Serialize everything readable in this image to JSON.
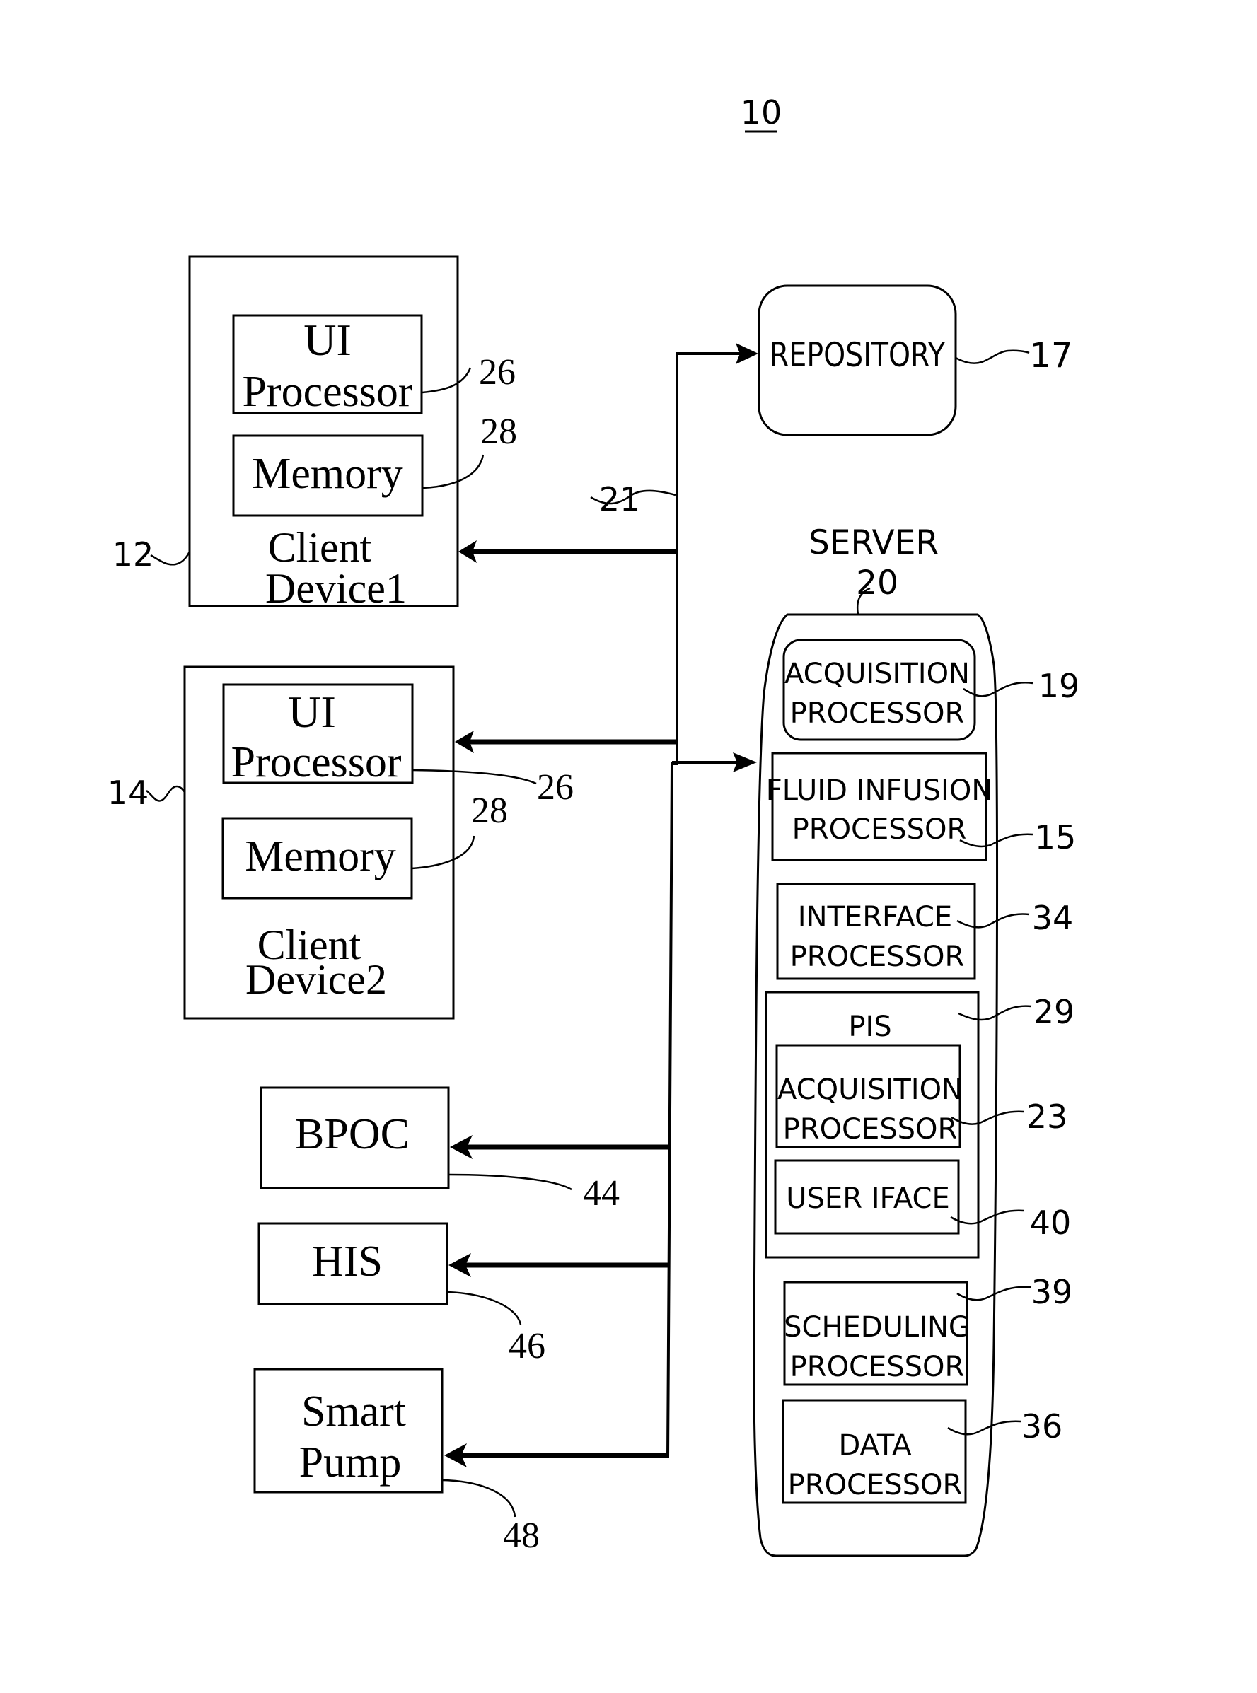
{
  "figure": {
    "reference_numeral": "10",
    "bus_label": "21"
  },
  "client_devices": [
    {
      "ref": "12",
      "title_line1": "Client",
      "title_line2": "Device1",
      "ui_processor": {
        "line1": "UI",
        "line2": "Processor",
        "ref": "26"
      },
      "memory": {
        "label": "Memory",
        "ref": "28"
      }
    },
    {
      "ref": "14",
      "title_line1": "Client",
      "title_line2": "Device2",
      "ui_processor": {
        "line1": "UI",
        "line2": "Processor",
        "ref": "26"
      },
      "memory": {
        "label": "Memory",
        "ref": "28"
      }
    }
  ],
  "external_systems": [
    {
      "label_line1": "BPOC",
      "label_line2": "",
      "ref": "44"
    },
    {
      "label_line1": "HIS",
      "label_line2": "",
      "ref": "46"
    },
    {
      "label_line1": "Smart",
      "label_line2": "Pump",
      "ref": "48"
    }
  ],
  "repository": {
    "label": "REPOSITORY",
    "ref": "17"
  },
  "server": {
    "title": "SERVER",
    "ref": "20",
    "components": [
      {
        "line1": "ACQUISITION",
        "line2": "PROCESSOR",
        "ref": "19"
      },
      {
        "line1": "FLUID INFUSION",
        "line2": "PROCESSOR",
        "ref": "15"
      },
      {
        "line1": "INTERFACE",
        "line2": "PROCESSOR",
        "ref": "34"
      }
    ],
    "pis": {
      "title": "PIS",
      "ref": "29",
      "components": [
        {
          "line1": "ACQUISITION",
          "line2": "PROCESSOR",
          "ref": "23"
        },
        {
          "line1": "USER IFACE",
          "line2": "",
          "ref": "40"
        }
      ]
    },
    "lower_components": [
      {
        "line1": "SCHEDULING",
        "line2": "PROCESSOR",
        "ref": "39"
      },
      {
        "line1": "DATA",
        "line2": "PROCESSOR",
        "ref": "36"
      }
    ]
  }
}
